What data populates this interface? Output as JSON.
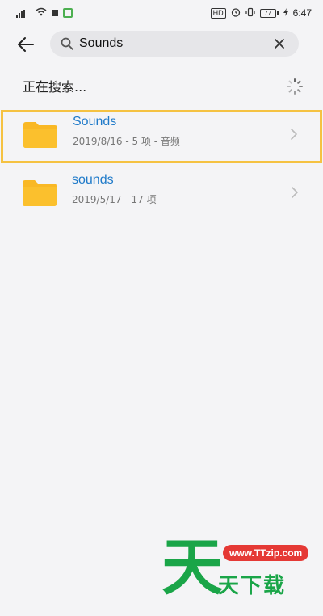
{
  "status_bar": {
    "network": "4G",
    "hd_label": "HD",
    "battery": "77",
    "time": "6:47"
  },
  "search": {
    "query": "Sounds",
    "placeholder": ""
  },
  "status": {
    "searching_text": "正在搜索..."
  },
  "results": [
    {
      "name": "Sounds",
      "meta": "2019/8/16 - 5 项 - 音频",
      "highlighted": true
    },
    {
      "name": "sounds",
      "meta": "2019/5/17 - 17 项",
      "highlighted": false
    }
  ],
  "watermark": {
    "big_char": "天",
    "url": "www.TTzip.com",
    "sub_text": "天下载"
  },
  "colors": {
    "accent_blue": "#1f7ac9",
    "folder_yellow": "#f9b825",
    "highlight_border": "#f5c242",
    "watermark_green": "#1aa548",
    "watermark_red": "#e53935"
  },
  "icons": {
    "back": "arrow-left-icon",
    "search": "search-icon",
    "clear": "close-icon",
    "spinner": "loading-spinner-icon",
    "folder": "folder-icon",
    "chevron": "chevron-right-icon"
  }
}
